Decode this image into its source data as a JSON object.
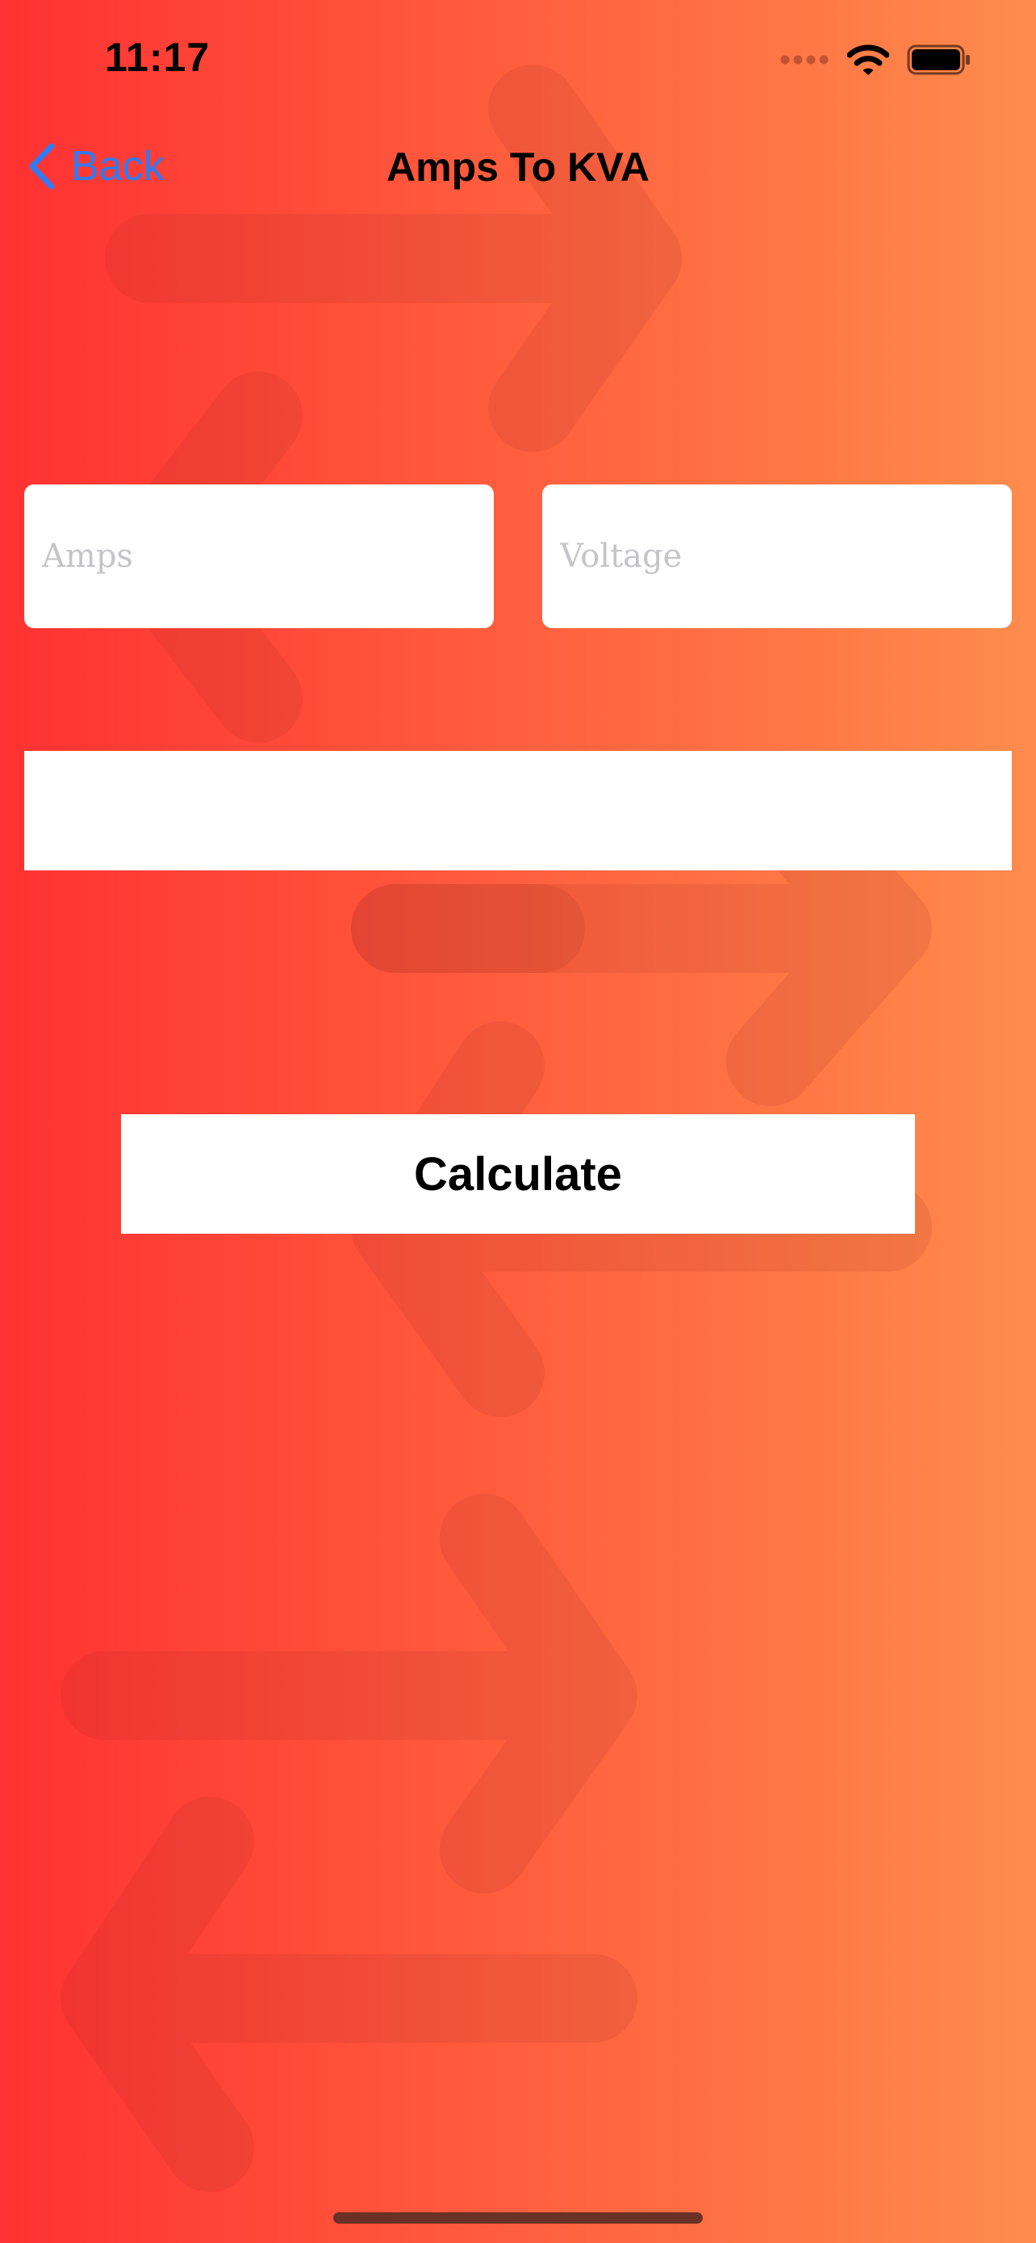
{
  "status_bar": {
    "time": "11:17",
    "icons": [
      "cellular-signal-icon",
      "wifi-icon",
      "battery-icon"
    ]
  },
  "nav": {
    "back_label": "Back",
    "title": "Amps To KVA"
  },
  "form": {
    "amps_placeholder": "Amps",
    "amps_value": "",
    "voltage_placeholder": "Voltage",
    "voltage_value": "",
    "result_text": ""
  },
  "actions": {
    "calculate_label": "Calculate"
  },
  "colors": {
    "gradient_start": "#ff3132",
    "gradient_end": "#ff8c4c",
    "back_accent": "#2f7bf6",
    "field_background": "#ffffff",
    "placeholder": "#c4c4c9"
  }
}
